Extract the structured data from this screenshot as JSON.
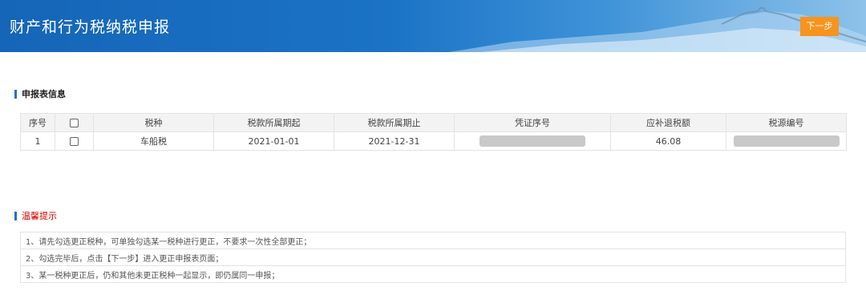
{
  "header": {
    "title": "财产和行为税纳税申报",
    "next_button": "下一步"
  },
  "declaration_section": {
    "title": "申报表信息",
    "columns": [
      "序号",
      "",
      "税种",
      "税款所属期起",
      "税款所属期止",
      "凭证序号",
      "应补退税额",
      "税源编号"
    ],
    "rows": [
      {
        "index": "1",
        "tax_type": "车船税",
        "period_start": "2021-01-01",
        "period_end": "2021-12-31",
        "voucher_no": "",
        "amount": "46.08",
        "source_no": ""
      }
    ]
  },
  "tips_section": {
    "title": "温馨提示",
    "items": [
      "1、请先勾选更正税种，可单独勾选某一税种进行更正，不要求一次性全部更正；",
      "2、勾选完毕后，点击【下一步】进入更正申报表页面；",
      "3、某一税种更正后，仍和其他未更正税种一起显示，即仍属同一申报；"
    ]
  },
  "colors": {
    "banner": "#1b73c6",
    "button": "#f7941d",
    "warning": "#d40000"
  }
}
